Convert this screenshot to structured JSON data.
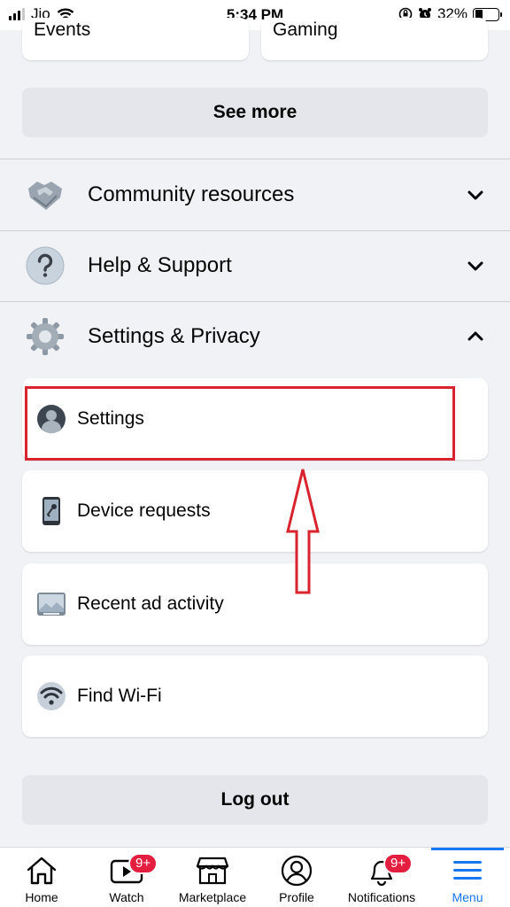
{
  "status_bar": {
    "carrier": "Jio",
    "time": "5:34 PM",
    "battery": "32%",
    "battery_level": 0.32
  },
  "shortcuts": {
    "left_label": "Events",
    "right_label": "Gaming"
  },
  "see_more_label": "See more",
  "sections": {
    "community": "Community resources",
    "help": "Help & Support",
    "settings_privacy": "Settings & Privacy"
  },
  "settings_items": {
    "settings": "Settings",
    "device_requests": "Device requests",
    "recent_ad_activity": "Recent ad activity",
    "find_wifi": "Find Wi-Fi"
  },
  "logout_label": "Log out",
  "bottom_nav": {
    "home": "Home",
    "watch": "Watch",
    "watch_badge": "9+",
    "marketplace": "Marketplace",
    "profile": "Profile",
    "notifications": "Notifications",
    "notifications_badge": "9+",
    "menu": "Menu"
  },
  "colors": {
    "accent": "#1877f2",
    "badge": "#e41e3f",
    "highlight": "#d9232e",
    "background": "#f0f2f5"
  }
}
